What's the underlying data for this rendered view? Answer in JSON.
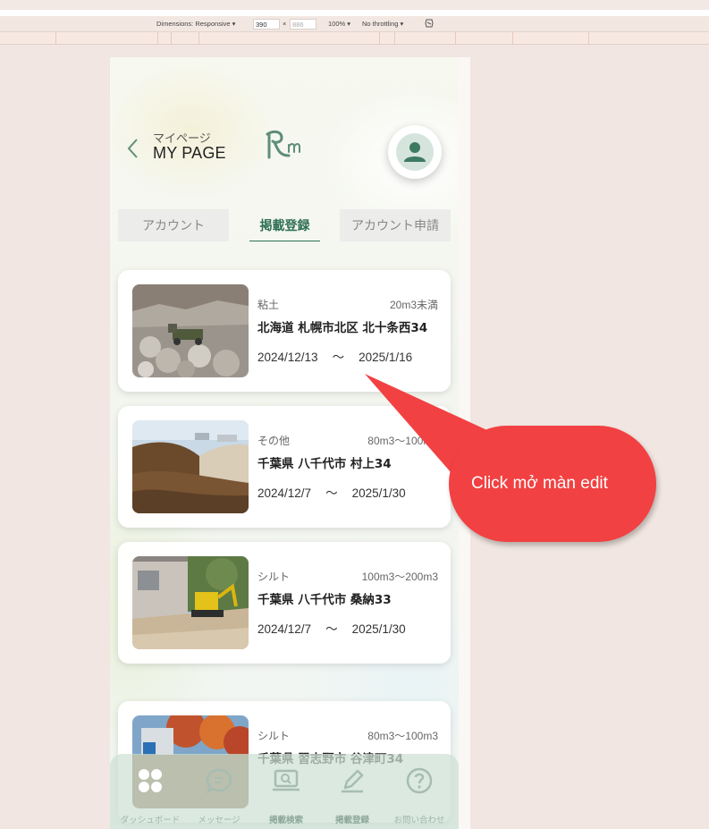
{
  "devtools": {
    "dimensions_label": "Dimensions: Responsive ▾",
    "width_value": "390",
    "separator": "×",
    "height_placeholder": "886",
    "zoom": "100% ▾",
    "throttling": "No throttling ▾"
  },
  "header": {
    "back_icon": "chevron-left-icon",
    "subtitle": "マイページ",
    "title": "MY PAGE",
    "logo_text": "Rm",
    "avatar_icon": "user-icon"
  },
  "tabs": [
    {
      "label": "アカウント",
      "active": false
    },
    {
      "label": "掲載登録",
      "active": true
    },
    {
      "label": "アカウント申請",
      "active": false
    }
  ],
  "listings": [
    {
      "type": "粘土",
      "volume": "20m3未満",
      "address": "北海道 札幌市北区 北十条西34",
      "start": "2024/12/13",
      "tilde": "〜",
      "end": "2025/1/16"
    },
    {
      "type": "その他",
      "volume": "80m3〜100m3",
      "address": "千葉県 八千代市 村上34",
      "start": "2024/12/7",
      "tilde": "〜",
      "end": "2025/1/30"
    },
    {
      "type": "シルト",
      "volume": "100m3〜200m3",
      "address": "千葉県 八千代市 桑納33",
      "start": "2024/12/7",
      "tilde": "〜",
      "end": "2025/1/30"
    },
    {
      "type": "シルト",
      "volume": "80m3〜100m3",
      "address": "千葉県 習志野市 谷津町34",
      "start": "",
      "tilde": "",
      "end": ""
    }
  ],
  "bottom_nav": [
    {
      "label": "ダッシュボード",
      "icon": "dashboard-icon"
    },
    {
      "label": "メッセージ",
      "icon": "message-icon"
    },
    {
      "label": "掲載検索",
      "icon": "search-listing-icon"
    },
    {
      "label": "掲載登録",
      "icon": "edit-icon"
    },
    {
      "label": "お問い合わせ",
      "icon": "help-icon"
    }
  ],
  "callout": {
    "text": "Click mở màn edit",
    "color": "#f24142"
  },
  "colors": {
    "accent": "#2e6e55",
    "tab_inactive_bg": "#ececeb"
  }
}
